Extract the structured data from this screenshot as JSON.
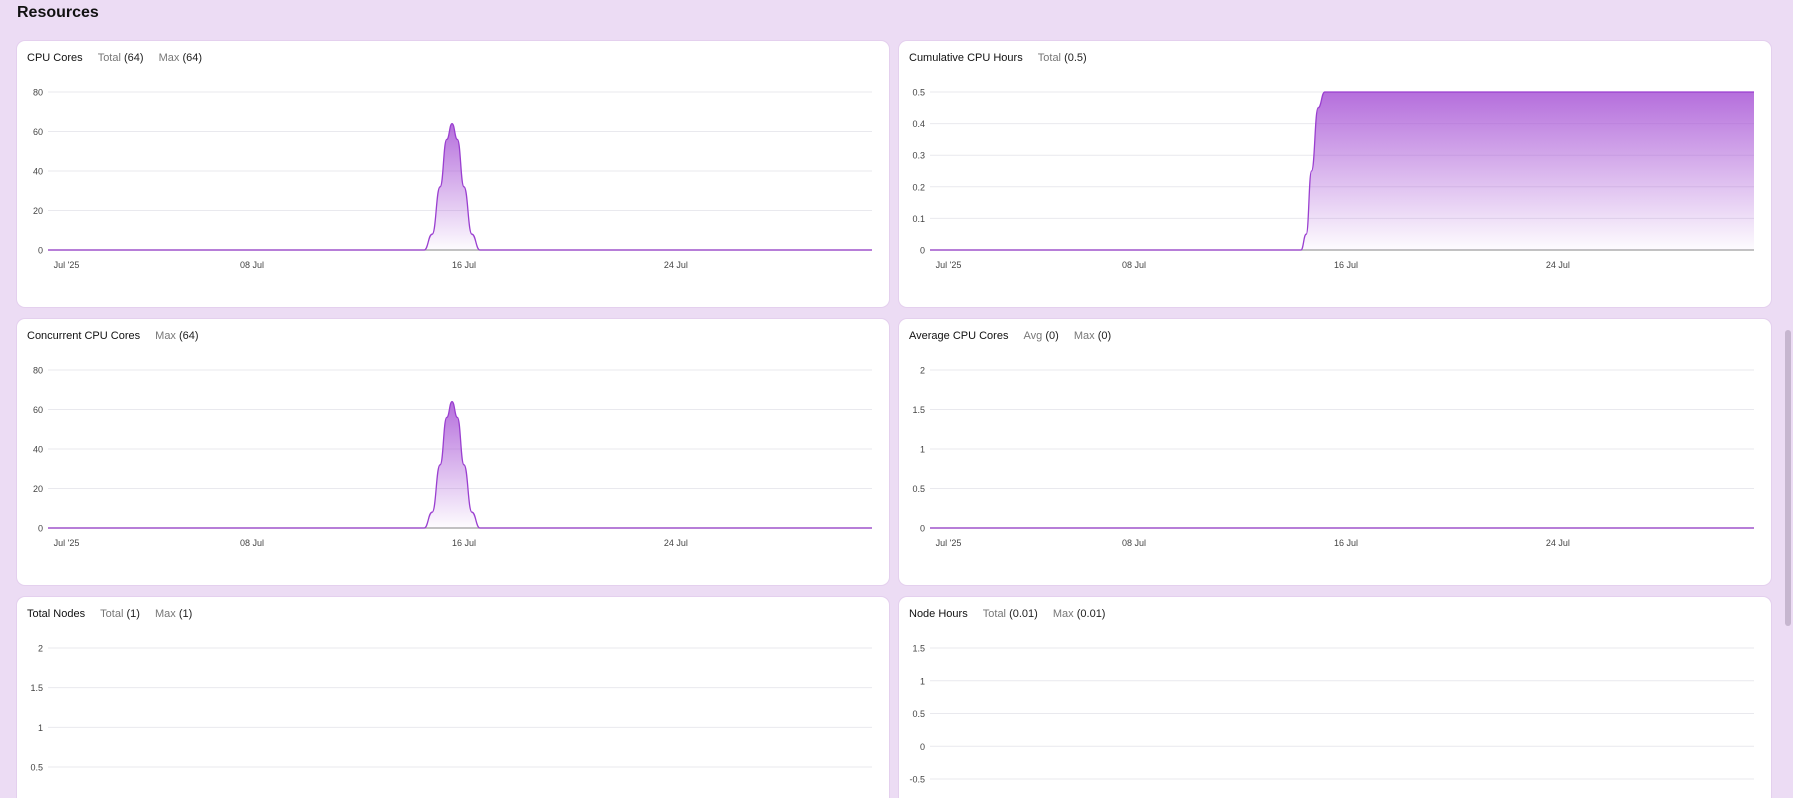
{
  "page": {
    "section_title": "Resources"
  },
  "colors": {
    "accent": "#a855d6",
    "accent_line": "#9a3fd0",
    "grid": "#e9e9ee",
    "axis": "#9e9e9e",
    "page_bg": "#ecdcf4"
  },
  "cards": [
    {
      "title": "CPU Cores",
      "stats": [
        {
          "label": "Total",
          "value": "(64)"
        },
        {
          "label": "Max",
          "value": "(64)"
        }
      ],
      "chart_data": {
        "type": "area",
        "y_ticks": [
          "80",
          "60",
          "40",
          "20",
          "0"
        ],
        "ylim": [
          0,
          80
        ],
        "x_ticks": [
          "Jul '25",
          "08 Jul",
          "16 Jul",
          "24 Jul"
        ],
        "x_tick_days": [
          1,
          8,
          16,
          24
        ],
        "xlim": [
          0.3,
          31.4
        ],
        "shape": "spike",
        "points": [
          [
            0.3,
            0
          ],
          [
            14.5,
            0
          ],
          [
            14.8,
            8
          ],
          [
            15.1,
            32
          ],
          [
            15.35,
            56
          ],
          [
            15.55,
            64
          ],
          [
            15.75,
            56
          ],
          [
            16.0,
            32
          ],
          [
            16.3,
            8
          ],
          [
            16.6,
            0
          ],
          [
            31.4,
            0
          ]
        ]
      }
    },
    {
      "title": "Cumulative CPU Hours",
      "stats": [
        {
          "label": "Total",
          "value": "(0.5)"
        }
      ],
      "chart_data": {
        "type": "area",
        "y_ticks": [
          "0.5",
          "0.4",
          "0.3",
          "0.2",
          "0.1",
          "0"
        ],
        "ylim": [
          0,
          0.5
        ],
        "x_ticks": [
          "Jul '25",
          "08 Jul",
          "16 Jul",
          "24 Jul"
        ],
        "x_tick_days": [
          1,
          8,
          16,
          24
        ],
        "xlim": [
          0.3,
          31.4
        ],
        "shape": "step",
        "points": [
          [
            0.3,
            0
          ],
          [
            14.3,
            0
          ],
          [
            14.5,
            0.05
          ],
          [
            14.7,
            0.25
          ],
          [
            14.95,
            0.45
          ],
          [
            15.2,
            0.5
          ],
          [
            31.4,
            0.5
          ]
        ]
      }
    },
    {
      "title": "Concurrent CPU Cores",
      "stats": [
        {
          "label": "Max",
          "value": "(64)"
        }
      ],
      "chart_data": {
        "type": "area",
        "y_ticks": [
          "80",
          "60",
          "40",
          "20",
          "0"
        ],
        "ylim": [
          0,
          80
        ],
        "x_ticks": [
          "Jul '25",
          "08 Jul",
          "16 Jul",
          "24 Jul"
        ],
        "x_tick_days": [
          1,
          8,
          16,
          24
        ],
        "xlim": [
          0.3,
          31.4
        ],
        "shape": "spike",
        "points": [
          [
            0.3,
            0
          ],
          [
            14.5,
            0
          ],
          [
            14.8,
            8
          ],
          [
            15.1,
            32
          ],
          [
            15.35,
            56
          ],
          [
            15.55,
            64
          ],
          [
            15.75,
            56
          ],
          [
            16.0,
            32
          ],
          [
            16.3,
            8
          ],
          [
            16.6,
            0
          ],
          [
            31.4,
            0
          ]
        ]
      }
    },
    {
      "title": "Average CPU Cores",
      "stats": [
        {
          "label": "Avg",
          "value": "(0)"
        },
        {
          "label": "Max",
          "value": "(0)"
        }
      ],
      "chart_data": {
        "type": "line",
        "y_ticks": [
          "2",
          "1.5",
          "1",
          "0.5",
          "0"
        ],
        "ylim": [
          0,
          2
        ],
        "x_ticks": [
          "Jul '25",
          "08 Jul",
          "16 Jul",
          "24 Jul"
        ],
        "x_tick_days": [
          1,
          8,
          16,
          24
        ],
        "xlim": [
          0.3,
          31.4
        ],
        "shape": "flat",
        "points": [
          [
            0.3,
            0
          ],
          [
            31.4,
            0
          ]
        ]
      }
    },
    {
      "title": "Total Nodes",
      "stats": [
        {
          "label": "Total",
          "value": "(1)"
        },
        {
          "label": "Max",
          "value": "(1)"
        }
      ],
      "chart_data": {
        "type": "line",
        "y_ticks": [
          "2",
          "1.5",
          "1",
          "0.5"
        ],
        "ylim": [
          0.5,
          2
        ],
        "x_ticks": [],
        "x_tick_days": [],
        "xlim": [
          0.3,
          31.4
        ],
        "shape": "none",
        "points": []
      }
    },
    {
      "title": "Node Hours",
      "stats": [
        {
          "label": "Total",
          "value": "(0.01)"
        },
        {
          "label": "Max",
          "value": "(0.01)"
        }
      ],
      "chart_data": {
        "type": "line",
        "y_ticks": [
          "1.5",
          "1",
          "0.5",
          "0",
          "-0.5"
        ],
        "ylim": [
          -0.5,
          1.5
        ],
        "x_ticks": [],
        "x_tick_days": [],
        "xlim": [
          0.3,
          31.4
        ],
        "shape": "none",
        "points": []
      }
    }
  ]
}
